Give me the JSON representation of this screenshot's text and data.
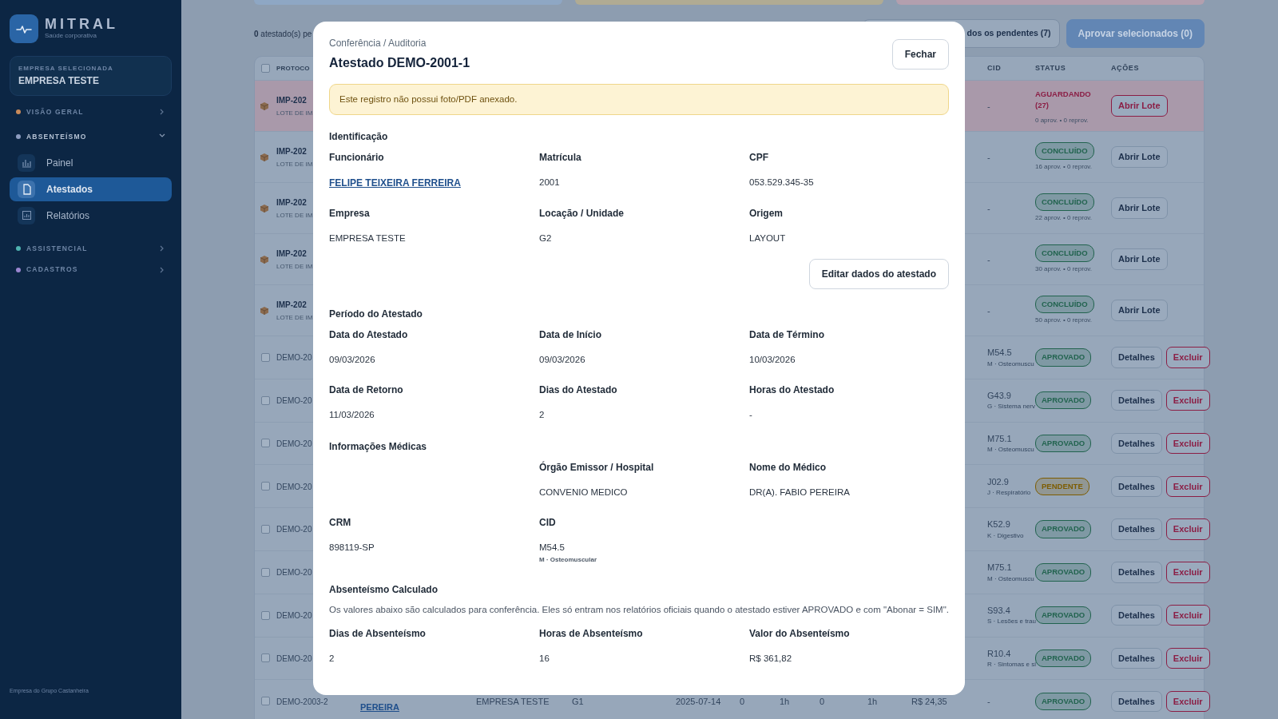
{
  "sidebar": {
    "brand": "MITRAL",
    "tagline": "Saúde corporativa",
    "company_label": "EMPRESA SELECIONADA",
    "company": "EMPRESA TESTE",
    "sections": [
      {
        "label": "VISÃO GERAL",
        "color": "#c98a5a",
        "expanded": false
      },
      {
        "label": "ABSENTEÍSMO",
        "color": "#8d9cc0",
        "expanded": true,
        "items": [
          {
            "label": "Painel",
            "kind": "chart",
            "selected": false
          },
          {
            "label": "Atestados",
            "kind": "document",
            "selected": true
          },
          {
            "label": "Relatórios",
            "kind": "report",
            "selected": false
          }
        ]
      },
      {
        "label": "ASSISTENCIAL",
        "color": "#4fb3b0",
        "expanded": false
      },
      {
        "label": "CADASTROS",
        "color": "#9a86d0",
        "expanded": false
      }
    ],
    "footer": "Empresa do Grupo Castanheira"
  },
  "toolbar": {
    "count_text": "**0** atestado(s) pe",
    "buttons": [
      {
        "label": "dos os pendentes (7)",
        "kind": "outline"
      },
      {
        "label": "Aprovar selecionados (0)",
        "kind": "primary"
      }
    ]
  },
  "table": {
    "select_all_checked": false,
    "columns": {
      "protocol": "PROTOCO",
      "cid": "CID",
      "status": "STATUS",
      "actions": "AÇÕES"
    },
    "rows": [
      {
        "kind": "lote",
        "protocol": "IMP-202",
        "sub": "LOTE DE IM",
        "cid": "-",
        "status": {
          "text": "AGUARDANDO (27)",
          "kind": "plain",
          "color": "#8b1e45"
        },
        "note": "0 aprov. • 0 reprov.",
        "highlighted": true,
        "actions": [
          "Abrir Lote"
        ]
      },
      {
        "kind": "lote",
        "protocol": "IMP-202",
        "sub": "LOTE DE IM",
        "cid": "-",
        "status": {
          "text": "CONCLUÍDO",
          "kind": "pill",
          "color": "#21634e"
        },
        "note": "16 aprov. • 0 reprov.",
        "highlighted": false,
        "actions": [
          "Abrir Lote"
        ]
      },
      {
        "kind": "lote",
        "protocol": "IMP-202",
        "sub": "LOTE DE IM",
        "cid": "-",
        "status": {
          "text": "CONCLUÍDO",
          "kind": "pill",
          "color": "#21634e"
        },
        "note": "22 aprov. • 0 reprov.",
        "highlighted": false,
        "actions": [
          "Abrir Lote"
        ]
      },
      {
        "kind": "lote",
        "protocol": "IMP-202",
        "sub": "LOTE DE IM",
        "cid": "-",
        "status": {
          "text": "CONCLUÍDO",
          "kind": "pill",
          "color": "#21634e"
        },
        "note": "30 aprov. • 0 reprov.",
        "highlighted": false,
        "actions": [
          "Abrir Lote"
        ]
      },
      {
        "kind": "lote",
        "protocol": "IMP-202",
        "sub": "LOTE DE IM",
        "cid": "-",
        "status": {
          "text": "CONCLUÍDO",
          "kind": "pill",
          "color": "#21634e"
        },
        "note": "50 aprov. • 0 reprov.",
        "highlighted": false,
        "actions": [
          "Abrir Lote"
        ]
      },
      {
        "kind": "atestado",
        "checked": false,
        "protocol": "DEMO-20",
        "cid": "M54.5",
        "cid_group": "M · Osteomuscu",
        "status": {
          "text": "APROVADO",
          "kind": "pill",
          "color": "#21634e"
        },
        "actions": [
          "Detalhes",
          "Excluir"
        ]
      },
      {
        "kind": "atestado",
        "checked": false,
        "protocol": "DEMO-20",
        "cid": "G43.9",
        "cid_group": "G · Sistema nerv",
        "status": {
          "text": "APROVADO",
          "kind": "pill",
          "color": "#21634e"
        },
        "actions": [
          "Detalhes",
          "Excluir"
        ]
      },
      {
        "kind": "atestado",
        "checked": false,
        "protocol": "DEMO-20",
        "cid": "M75.1",
        "cid_group": "M · Osteomuscu",
        "status": {
          "text": "APROVADO",
          "kind": "pill",
          "color": "#21634e"
        },
        "actions": [
          "Detalhes",
          "Excluir"
        ]
      },
      {
        "kind": "atestado",
        "checked": false,
        "protocol": "DEMO-20",
        "cid": "J02.9",
        "cid_group": "J · Respiratório",
        "status": {
          "text": "PENDENTE",
          "kind": "pill",
          "color": "#7d5c00"
        },
        "actions": [
          "Detalhes",
          "Excluir"
        ]
      },
      {
        "kind": "atestado",
        "checked": false,
        "protocol": "DEMO-20",
        "cid": "K52.9",
        "cid_group": "K · Digestivo",
        "status": {
          "text": "APROVADO",
          "kind": "pill",
          "color": "#21634e"
        },
        "actions": [
          "Detalhes",
          "Excluir"
        ]
      },
      {
        "kind": "atestado",
        "checked": false,
        "protocol": "DEMO-20",
        "cid": "M75.1",
        "cid_group": "M · Osteomuscu",
        "status": {
          "text": "APROVADO",
          "kind": "pill",
          "color": "#21634e"
        },
        "actions": [
          "Detalhes",
          "Excluir"
        ]
      },
      {
        "kind": "atestado",
        "checked": false,
        "protocol": "DEMO-20",
        "cid": "S93.4",
        "cid_group": "S · Lesões e trau",
        "status": {
          "text": "APROVADO",
          "kind": "pill",
          "color": "#21634e"
        },
        "actions": [
          "Detalhes",
          "Excluir"
        ]
      },
      {
        "kind": "atestado",
        "checked": false,
        "protocol": "DEMO-20",
        "cid": "R10.4",
        "cid_group": "R · Sintomas e si",
        "status": {
          "text": "APROVADO",
          "kind": "pill",
          "color": "#21634e"
        },
        "actions": [
          "Detalhes",
          "Excluir"
        ]
      },
      {
        "kind": "atestado",
        "checked": false,
        "protocol": "DEMO-2003-2",
        "name": "PEREIRA",
        "cells": [
          "EMPRESA TESTE",
          "G1",
          "2025-07-14",
          "0",
          "1h",
          "0",
          "1h",
          "R$ 24,35"
        ],
        "cid": "-",
        "status": {
          "text": "APROVADO",
          "kind": "pill",
          "color": "#21634e"
        },
        "actions": [
          "Detalhes",
          "Excluir"
        ]
      }
    ]
  },
  "modal": {
    "breadcrumb": "Conferência / Auditoria",
    "title": "Atestado DEMO-2001-1",
    "close": "Fechar",
    "alert": "Este registro não possui foto/PDF anexado.",
    "sections": [
      {
        "title": "Identificação",
        "fields": [
          {
            "label": "Funcionário",
            "value": "FELIPE TEIXEIRA FERREIRA",
            "kind": "link"
          },
          {
            "label": "Matrícula",
            "value": "2001",
            "kind": "text"
          },
          {
            "label": "CPF",
            "value": "053.529.345-35",
            "kind": "text"
          },
          {
            "label": "Empresa",
            "value": "EMPRESA TESTE",
            "kind": "text"
          },
          {
            "label": "Locação / Unidade",
            "value": "G2",
            "kind": "text"
          },
          {
            "label": "Origem",
            "value": "LAYOUT",
            "kind": "text"
          }
        ],
        "button": "Editar dados do atestado"
      },
      {
        "title": "Período do Atestado",
        "fields": [
          {
            "label": "Data do Atestado",
            "value": "09/03/2026",
            "kind": "text"
          },
          {
            "label": "Data de Início",
            "value": "09/03/2026",
            "kind": "text"
          },
          {
            "label": "Data de Término",
            "value": "10/03/2026",
            "kind": "text"
          },
          {
            "label": "Data de Retorno",
            "value": "11/03/2026",
            "kind": "text"
          },
          {
            "label": "Dias do Atestado",
            "value": "2",
            "kind": "text"
          },
          {
            "label": "Horas do Atestado",
            "value": "-",
            "kind": "text"
          }
        ]
      },
      {
        "title": "Informações Médicas",
        "fields": [
          {
            "kind": "spacer"
          },
          {
            "label": "Órgão Emissor / Hospital",
            "value": "CONVENIO MEDICO",
            "kind": "text"
          },
          {
            "label": "Nome do Médico",
            "value": "DR(A). FABIO PEREIRA",
            "kind": "text"
          },
          {
            "label": "CRM",
            "value": "898119-SP",
            "kind": "text"
          },
          {
            "label": "CID",
            "value": "M54.5",
            "sub": "M · Osteomuscular",
            "kind": "text"
          }
        ]
      },
      {
        "title": "Absenteísmo Calculado",
        "description": "Os valores abaixo são calculados para conferência. Eles só entram nos relatórios oficiais quando o atestado estiver APROVADO e com \"Abonar = SIM\".",
        "fields": [
          {
            "label": "Dias de Absenteísmo",
            "value": "2",
            "kind": "text"
          },
          {
            "label": "Horas de Absenteísmo",
            "value": "16",
            "kind": "text"
          },
          {
            "label": "Valor do Absenteísmo",
            "value": "R$ 361,82",
            "kind": "text"
          }
        ]
      }
    ]
  }
}
